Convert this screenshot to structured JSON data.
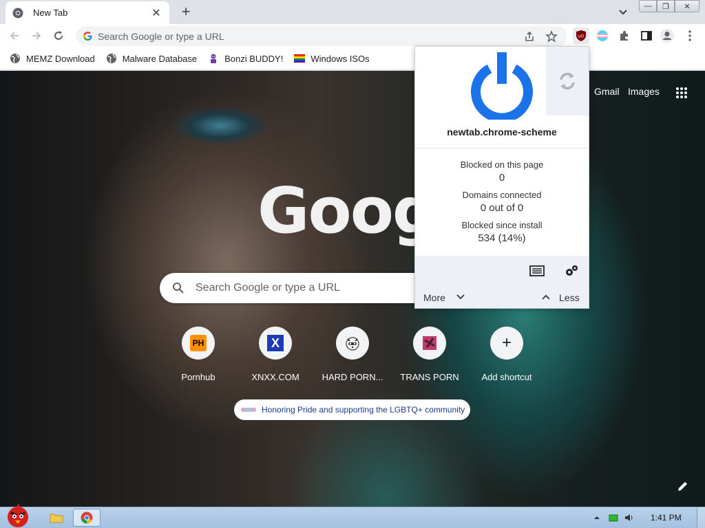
{
  "tab": {
    "title": "New Tab",
    "close": "✕",
    "new_tab": "+"
  },
  "window_controls": {
    "minimize": "—",
    "restore": "❐",
    "close": "✕"
  },
  "toolbar": {
    "omnibox_placeholder": "Search Google or type a URL"
  },
  "bookmarks": [
    {
      "label": "MEMZ Download",
      "icon": "globe-icon"
    },
    {
      "label": "Malware Database",
      "icon": "globe-icon"
    },
    {
      "label": "Bonzi BUDDY!",
      "icon": "bonzi-icon"
    },
    {
      "label": "Windows ISOs",
      "icon": "windows-flag-icon"
    }
  ],
  "ntp": {
    "links": {
      "gmail": "Gmail",
      "images": "Images"
    },
    "logo": "Googl",
    "search_placeholder": "Search Google or type a URL",
    "shortcuts": [
      {
        "label": "Pornhub",
        "icon_text": "PH"
      },
      {
        "label": "XNXX.COM",
        "icon_text": "X"
      },
      {
        "label": "HARD PORN...",
        "icon_text": ""
      },
      {
        "label": "TRANS PORN",
        "icon_text": ""
      },
      {
        "label": "Add shortcut",
        "icon_text": "+"
      }
    ],
    "pride_banner": "Honoring Pride and supporting the LGBTQ+ community"
  },
  "ublock": {
    "hostname": "newtab.chrome-scheme",
    "stats": [
      {
        "label": "Blocked on this page",
        "value": "0"
      },
      {
        "label": "Domains connected",
        "value": "0 out of 0"
      },
      {
        "label": "Blocked since install",
        "value": "534 (14%)"
      }
    ],
    "more": "More",
    "less": "Less"
  },
  "taskbar": {
    "clock": "1:41 PM"
  },
  "colors": {
    "ublock_blue": "#1a73e8",
    "ublock_red": "#800000",
    "chrome_bg": "#dee1e6"
  }
}
